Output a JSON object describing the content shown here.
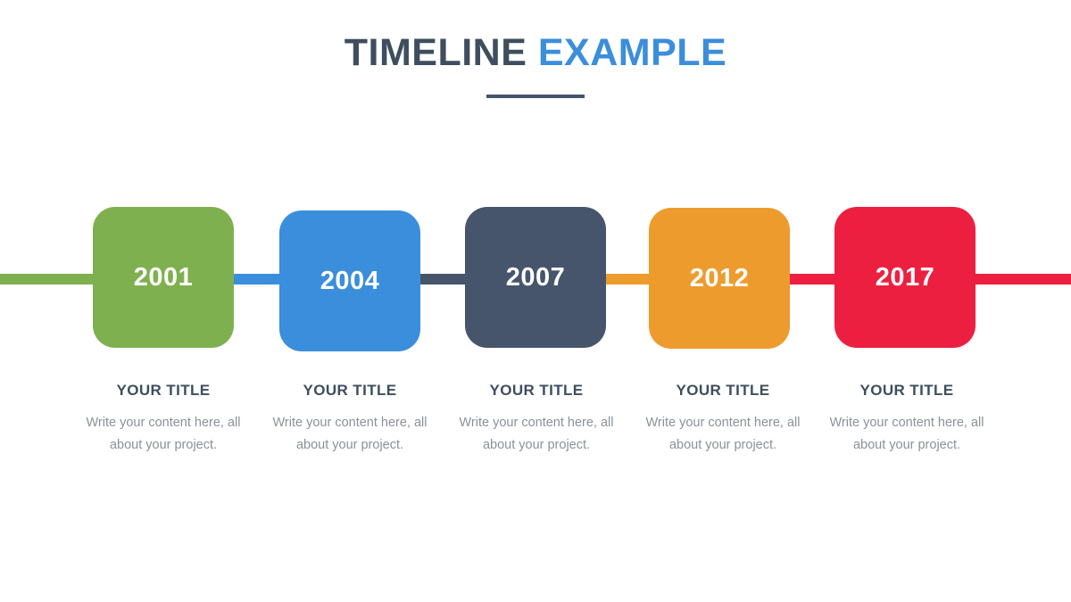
{
  "heading": {
    "primary": "TIMELINE ",
    "accent": "EXAMPLE"
  },
  "theme": {
    "background": "#ffffff",
    "heading_primary_color": "#3e4e5e",
    "heading_accent_color": "#3b8edb",
    "rule_color": "#44546a",
    "title_color": "#3e4e5e",
    "body_color": "#8b9199",
    "year_color": "#ffffff"
  },
  "chart_data": {
    "type": "timeline",
    "title": "TIMELINE EXAMPLE",
    "orientation": "horizontal",
    "milestone_count": 5,
    "years": [
      "2001",
      "2004",
      "2007",
      "2012",
      "2017"
    ],
    "colors": [
      "#7fb04f",
      "#3b8edb",
      "#46556b",
      "#ee9b2e",
      "#ed1f40"
    ]
  },
  "milestones": [
    {
      "year": "2001",
      "color": "#7fb04f",
      "title": "YOUR TITLE",
      "body": "Write your content here, all about your project."
    },
    {
      "year": "2004",
      "color": "#3b8edb",
      "title": "YOUR TITLE",
      "body": "Write your content here, all about your project."
    },
    {
      "year": "2007",
      "color": "#46556b",
      "title": "YOUR TITLE",
      "body": "Write your content here, all about your project."
    },
    {
      "year": "2012",
      "color": "#ee9b2e",
      "title": "YOUR TITLE",
      "body": "Write your content here, all about your project."
    },
    {
      "year": "2017",
      "color": "#ed1f40",
      "title": "YOUR TITLE",
      "body": "Write your content here, all about your project."
    }
  ]
}
